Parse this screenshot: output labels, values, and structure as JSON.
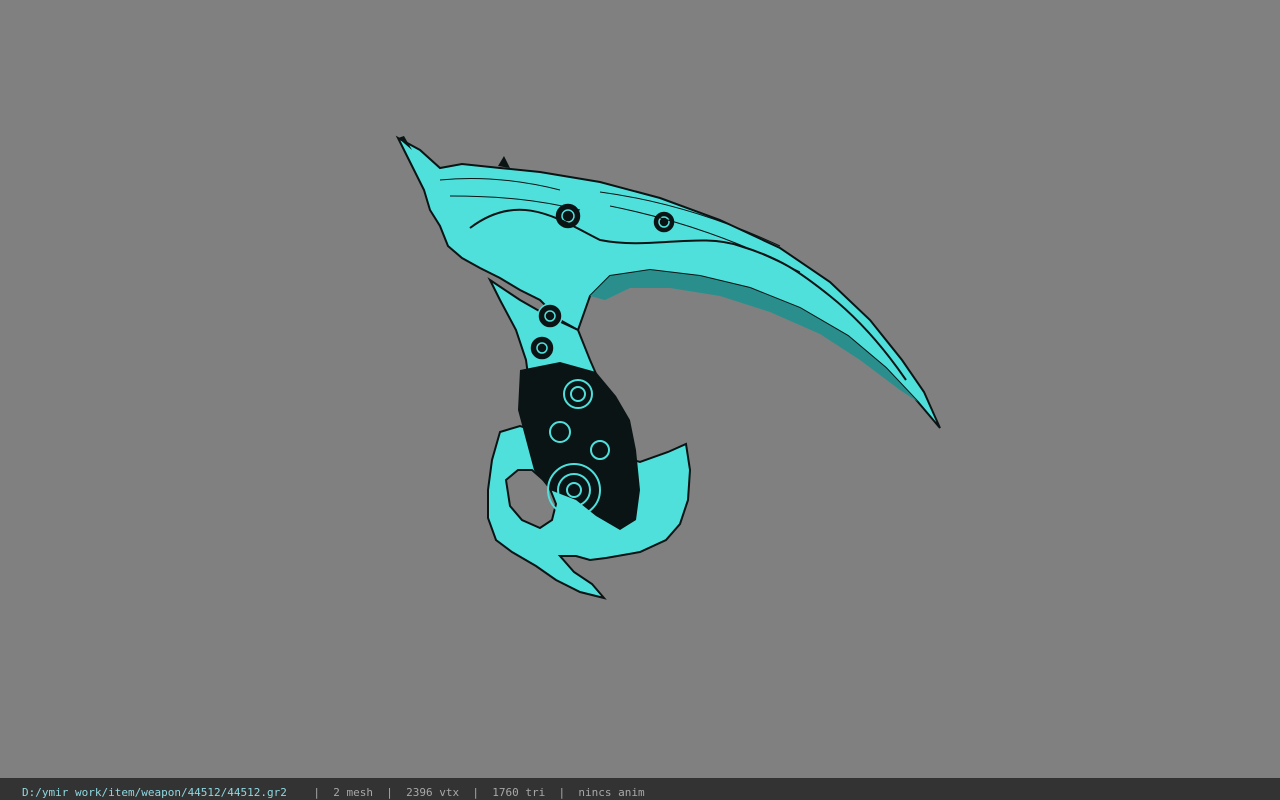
{
  "viewer": {
    "background_color": "#808080",
    "model_color": "#4fe0dc",
    "model_line_color": "#0a1414"
  },
  "status_bar": {
    "file_path": "D:/ymir work/item/weapon/44512/44512.gr2",
    "separator": "|",
    "mesh": "2 mesh",
    "vertices": "2396 vtx",
    "triangles": "1760 tri",
    "animation": "nincs anim"
  }
}
